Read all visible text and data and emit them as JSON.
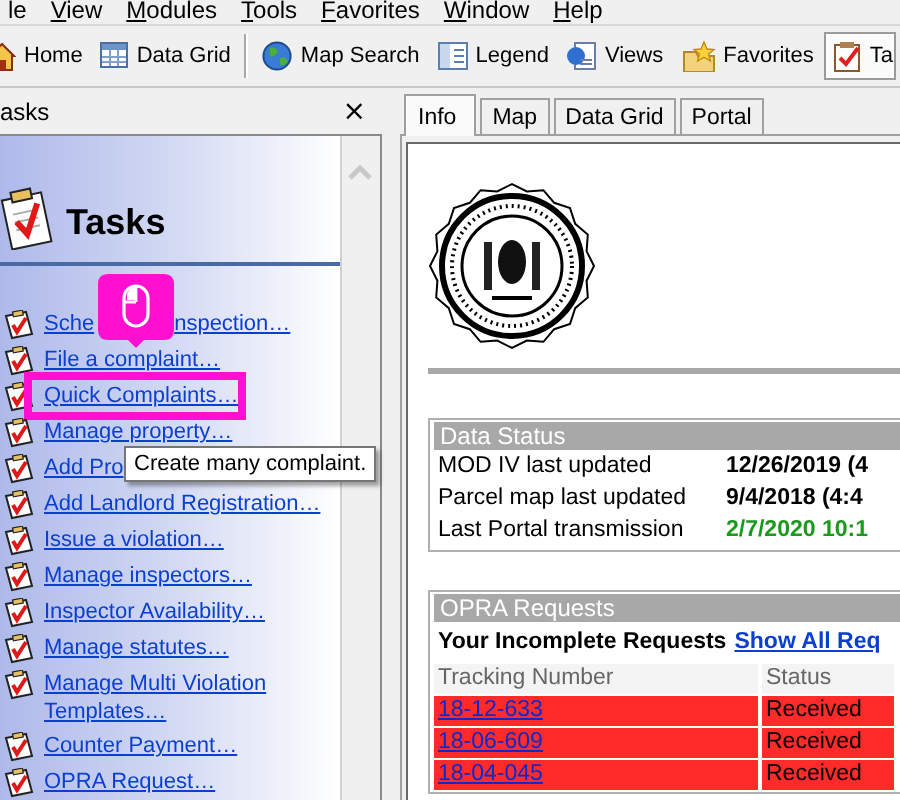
{
  "menu_bar": [
    {
      "label": "le",
      "mnemonic": false
    },
    {
      "label": "View",
      "mnemonic": true
    },
    {
      "label": "Modules",
      "mnemonic": true
    },
    {
      "label": "Tools",
      "mnemonic": true
    },
    {
      "label": "Favorites",
      "mnemonic": true
    },
    {
      "label": "Window",
      "mnemonic": true
    },
    {
      "label": "Help",
      "mnemonic": true
    }
  ],
  "toolbar": [
    {
      "kind": "button",
      "label": "Home",
      "selected": false
    },
    {
      "kind": "button",
      "label": "Data Grid",
      "selected": false
    },
    {
      "kind": "separator"
    },
    {
      "kind": "button",
      "label": "Map Search",
      "selected": false
    },
    {
      "kind": "button",
      "label": "Legend",
      "selected": false
    },
    {
      "kind": "button",
      "label": "Views",
      "selected": false
    },
    {
      "kind": "button",
      "label": "Favorites",
      "selected": false
    },
    {
      "kind": "button",
      "label": "Ta",
      "selected": true
    }
  ],
  "task_pane": {
    "title": "asks",
    "close": "×",
    "heading": "Tasks",
    "links": [
      {
        "label": "Sche",
        "label_end": "nspection…",
        "highlighted": false
      },
      {
        "label": "File a complaint…",
        "highlighted": false
      },
      {
        "label": "Quick Complaints…",
        "highlighted": true,
        "tooltip": "Create many complaint."
      },
      {
        "label": "Manage property…",
        "highlighted": false
      },
      {
        "label": "Add Pro",
        "highlighted": false
      },
      {
        "label": "Add Landlord Registration…",
        "highlighted": false
      },
      {
        "label": "Issue a violation…",
        "highlighted": false
      },
      {
        "label": "Manage inspectors…",
        "highlighted": false
      },
      {
        "label": "Inspector Availability…",
        "highlighted": false
      },
      {
        "label": "Manage statutes…",
        "highlighted": false
      },
      {
        "label": "Manage Multi Violation Templates…",
        "highlighted": false
      },
      {
        "label": "Counter Payment…",
        "highlighted": false
      },
      {
        "label": "OPRA Request…",
        "highlighted": false
      }
    ]
  },
  "tabs": [
    {
      "label": "Info",
      "selected": true
    },
    {
      "label": "Map",
      "selected": false
    },
    {
      "label": "Data Grid",
      "selected": false
    },
    {
      "label": "Portal",
      "selected": false
    }
  ],
  "data_status": {
    "title": "Data Status",
    "rows": [
      {
        "label": "MOD IV last updated",
        "value": "12/26/2019 (4",
        "color": "#000000"
      },
      {
        "label": "Parcel map last updated",
        "value": "9/4/2018 (4:4",
        "color": "#000000"
      },
      {
        "label": "Last Portal transmission",
        "value": "2/7/2020 10:1",
        "color": "#1a9a1a"
      }
    ]
  },
  "opra_requests": {
    "title": "OPRA Requests",
    "heading": "Your Incomplete Requests",
    "link": "Show All Req",
    "columns": [
      "Tracking Number",
      "Status"
    ],
    "rows": [
      {
        "tracking": "18-12-633",
        "status": "Received",
        "color": "#ff2a2a"
      },
      {
        "tracking": "18-06-609",
        "status": "Received",
        "color": "#ff2a2a"
      },
      {
        "tracking": "18-04-045",
        "status": "Received",
        "color": "#ff2a2a"
      }
    ]
  }
}
